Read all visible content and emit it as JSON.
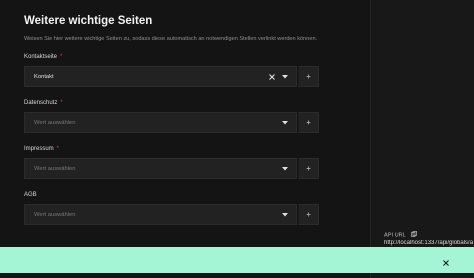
{
  "section": {
    "title": "Weitere wichtige Seiten",
    "description": "Weisen Sie hier weitere wichtige Seiten zu, sodass diese automatisch an notwendigen Stellen verlinkt werden können."
  },
  "fields": [
    {
      "label": "Kontaktseite",
      "required": "*",
      "value": "Kontakt",
      "placeholder": ""
    },
    {
      "label": "Datenschutz",
      "required": "*",
      "value": "",
      "placeholder": "Wert auswählen"
    },
    {
      "label": "Impressum",
      "required": "*",
      "value": "",
      "placeholder": "Wert auswählen"
    },
    {
      "label": "AGB",
      "required": "",
      "value": "",
      "placeholder": "Wert auswählen"
    }
  ],
  "add_label": "+",
  "sidebar": {
    "api_label": "API URL",
    "api_url": "http://localhost:1337/api/globals/a"
  },
  "icons": {
    "clear": "close-icon",
    "dropdown": "chevron-down-icon",
    "copy": "copy-icon",
    "toast_close": "close-icon"
  },
  "colors": {
    "toast": "#a3f5d6",
    "required": "#c94b4b"
  }
}
